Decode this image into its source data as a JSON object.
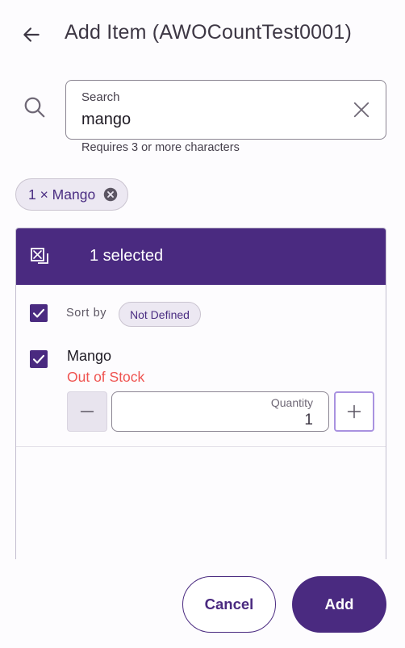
{
  "header": {
    "title": "Add Item (AWOCountTest0001)",
    "back_icon": "arrow-left-icon"
  },
  "search": {
    "label": "Search",
    "value": "mango",
    "placeholder": "",
    "helper": "Requires 3 or more characters",
    "icon": "search-icon",
    "clear_icon": "close-icon"
  },
  "selected_chips": [
    {
      "label": "1 × Mango",
      "remove_icon": "cancel-circle-icon"
    }
  ],
  "panel": {
    "selected_count": "1 selected",
    "header_icon": "deselect-icon",
    "select_all_checked": true,
    "sort_by_label": "Sort by",
    "sort_value": "Not Defined",
    "items": [
      {
        "name": "Mango",
        "status": "Out of Stock",
        "checked": true,
        "quantity_label": "Quantity",
        "quantity": "1"
      }
    ]
  },
  "footer": {
    "cancel_label": "Cancel",
    "add_label": "Add"
  },
  "colors": {
    "primary": "#4a2a80",
    "error": "#ef5350",
    "chip_bg": "#ece8f2"
  }
}
